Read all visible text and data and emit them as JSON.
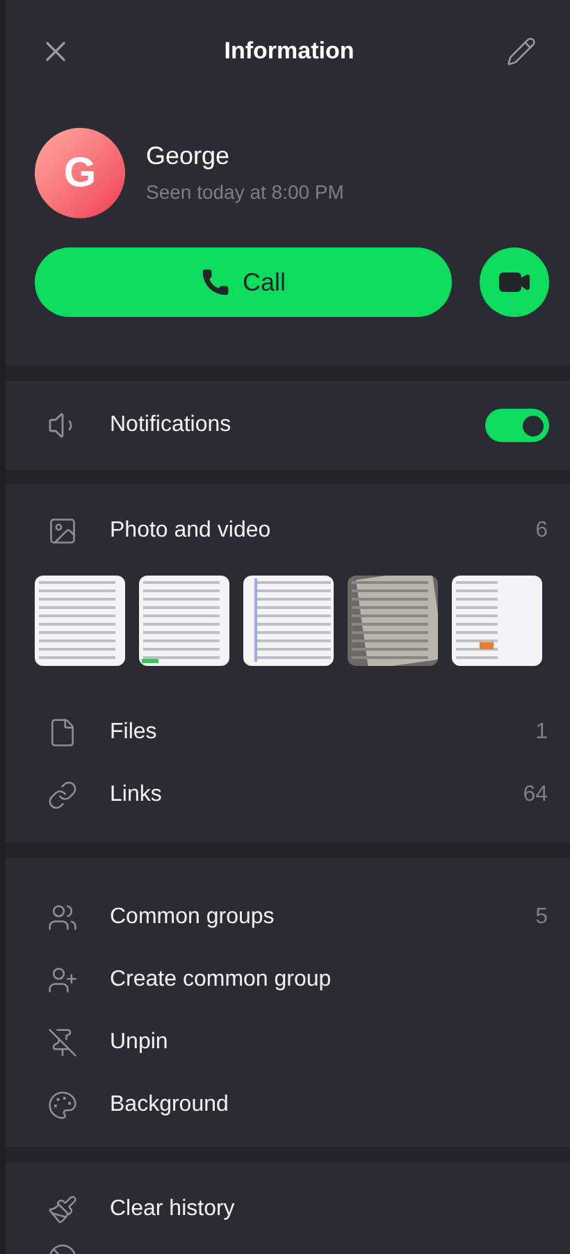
{
  "header": {
    "title": "Information"
  },
  "profile": {
    "initial": "G",
    "name": "George",
    "status": "Seen today at 8:00 PM"
  },
  "call_button": {
    "label": "Call"
  },
  "notifications": {
    "label": "Notifications",
    "on": true
  },
  "media": {
    "label": "Photo and video",
    "count": "6"
  },
  "shared": [
    {
      "kind": "files",
      "label": "Files",
      "count": "1"
    },
    {
      "kind": "links",
      "label": "Links",
      "count": "64"
    }
  ],
  "actions": [
    {
      "kind": "groups",
      "label": "Common groups",
      "count": "5"
    },
    {
      "kind": "create",
      "label": "Create common group"
    },
    {
      "kind": "unpin",
      "label": "Unpin"
    },
    {
      "kind": "background",
      "label": "Background"
    }
  ],
  "danger": [
    {
      "kind": "clear",
      "label": "Clear history"
    }
  ]
}
